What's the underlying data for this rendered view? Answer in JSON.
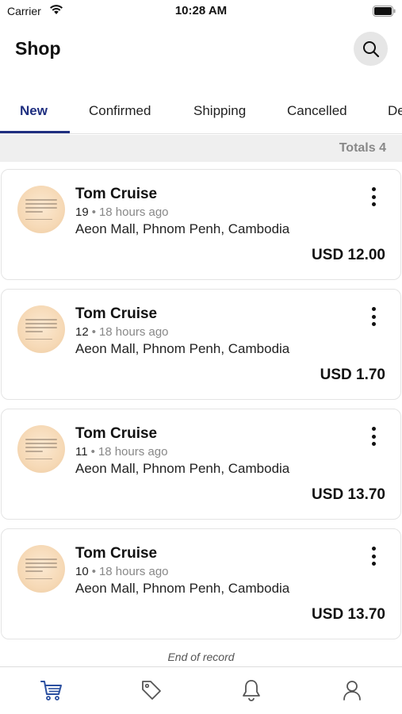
{
  "status_bar": {
    "carrier": "Carrier",
    "time": "10:28 AM"
  },
  "header": {
    "title": "Shop",
    "search_icon": "search-icon"
  },
  "tabs": [
    {
      "label": "New",
      "active": true
    },
    {
      "label": "Confirmed",
      "active": false
    },
    {
      "label": "Shipping",
      "active": false
    },
    {
      "label": "Cancelled",
      "active": false
    },
    {
      "label": "De",
      "active": false
    }
  ],
  "totals": {
    "text": "Totals 4"
  },
  "orders": [
    {
      "name": "Tom Cruise",
      "number": "19",
      "ago": "18 hours ago",
      "address": "Aeon Mall, Phnom Penh, Cambodia",
      "amount": "USD 12.00"
    },
    {
      "name": "Tom Cruise",
      "number": "12",
      "ago": "18 hours ago",
      "address": "Aeon Mall, Phnom Penh, Cambodia",
      "amount": "USD 1.70"
    },
    {
      "name": "Tom Cruise",
      "number": "11",
      "ago": "18 hours ago",
      "address": "Aeon Mall, Phnom Penh, Cambodia",
      "amount": "USD 13.70"
    },
    {
      "name": "Tom Cruise",
      "number": "10",
      "ago": "18 hours ago",
      "address": "Aeon Mall, Phnom Penh, Cambodia",
      "amount": "USD 13.70"
    }
  ],
  "footer_note": "End of record",
  "bottom_nav": [
    {
      "icon": "cart-icon",
      "active": true
    },
    {
      "icon": "tag-icon",
      "active": false
    },
    {
      "icon": "bell-icon",
      "active": false
    },
    {
      "icon": "user-icon",
      "active": false
    }
  ],
  "colors": {
    "accent": "#1f2f80",
    "nav_active": "#2a4fa0",
    "nav_inactive": "#555555",
    "muted_text": "#888888",
    "totals_bg": "#efefef"
  }
}
